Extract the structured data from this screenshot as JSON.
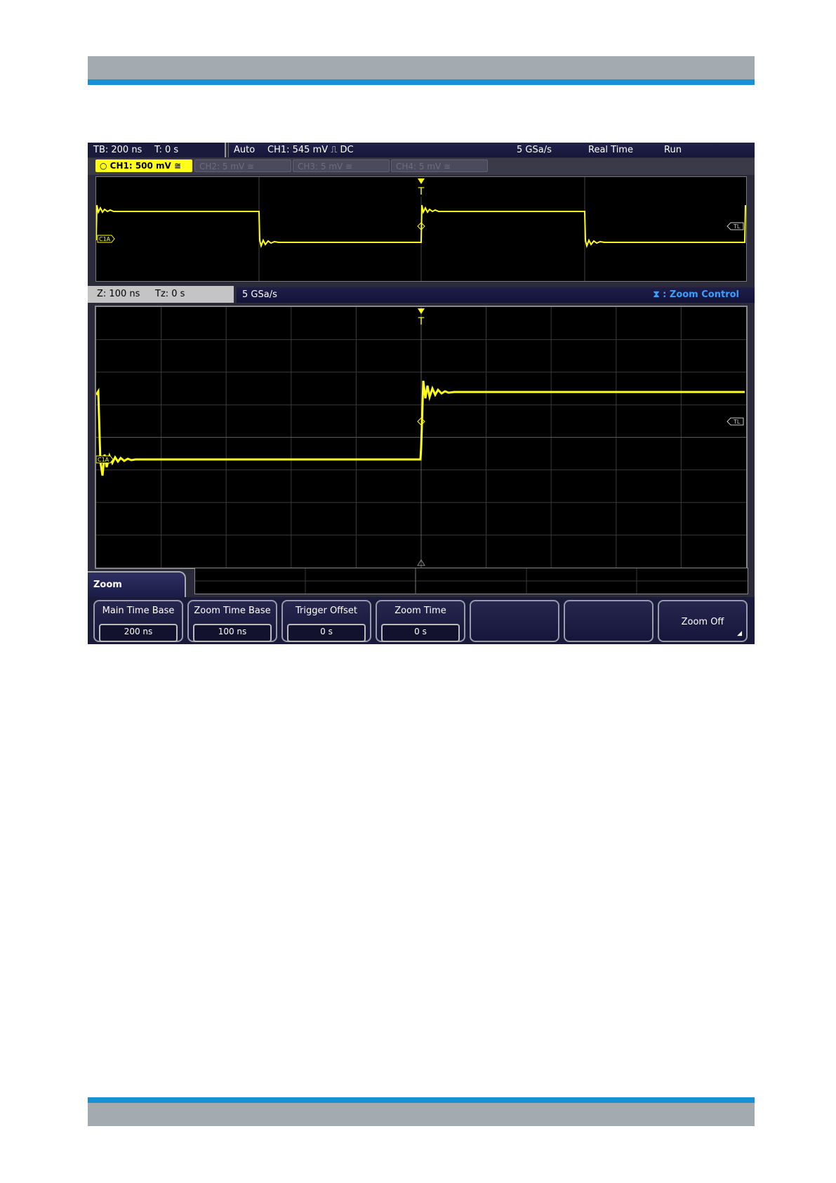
{
  "status": {
    "timebase": "TB: 200 ns",
    "trigger_time": "T: 0 s",
    "trigger_mode": "Auto",
    "trigger_level": "CH1: 545 mV ⎍ DC",
    "sample_rate": "5 GSa/s",
    "acq_mode": "Real Time",
    "run_state": "Run"
  },
  "channels": [
    {
      "label": "○ CH1: 500 mV ≅",
      "active": true
    },
    {
      "label": "CH2: 5 mV ≅",
      "active": false
    },
    {
      "label": "CH3: 5 mV ≅",
      "active": false
    },
    {
      "label": "CH4: 5 mV ≅",
      "active": false
    }
  ],
  "markers": {
    "trigger": "T",
    "channel_marker": "C1A",
    "trigger_level_marker": "TL"
  },
  "zoom_bar": {
    "zoom_timebase": "Z: 100 ns",
    "zoom_time": "Tz: 0 s",
    "sample_rate": "5 GSa/s",
    "control_label": ": Zoom Control"
  },
  "menu": {
    "title": "Zoom",
    "softkeys": [
      {
        "label": "Main Time Base",
        "value": "200 ns"
      },
      {
        "label": "Zoom Time Base",
        "value": "100 ns"
      },
      {
        "label": "Trigger Offset",
        "value": "0 s"
      },
      {
        "label": "Zoom Time",
        "value": "0 s"
      },
      {
        "label": "",
        "value": ""
      },
      {
        "label": "",
        "value": ""
      },
      {
        "label": "Zoom Off",
        "value": ""
      }
    ]
  },
  "colors": {
    "trace": "#ffff1a",
    "accent_blue": "#1a8fd4",
    "zoom_control": "#3aa0ff"
  }
}
